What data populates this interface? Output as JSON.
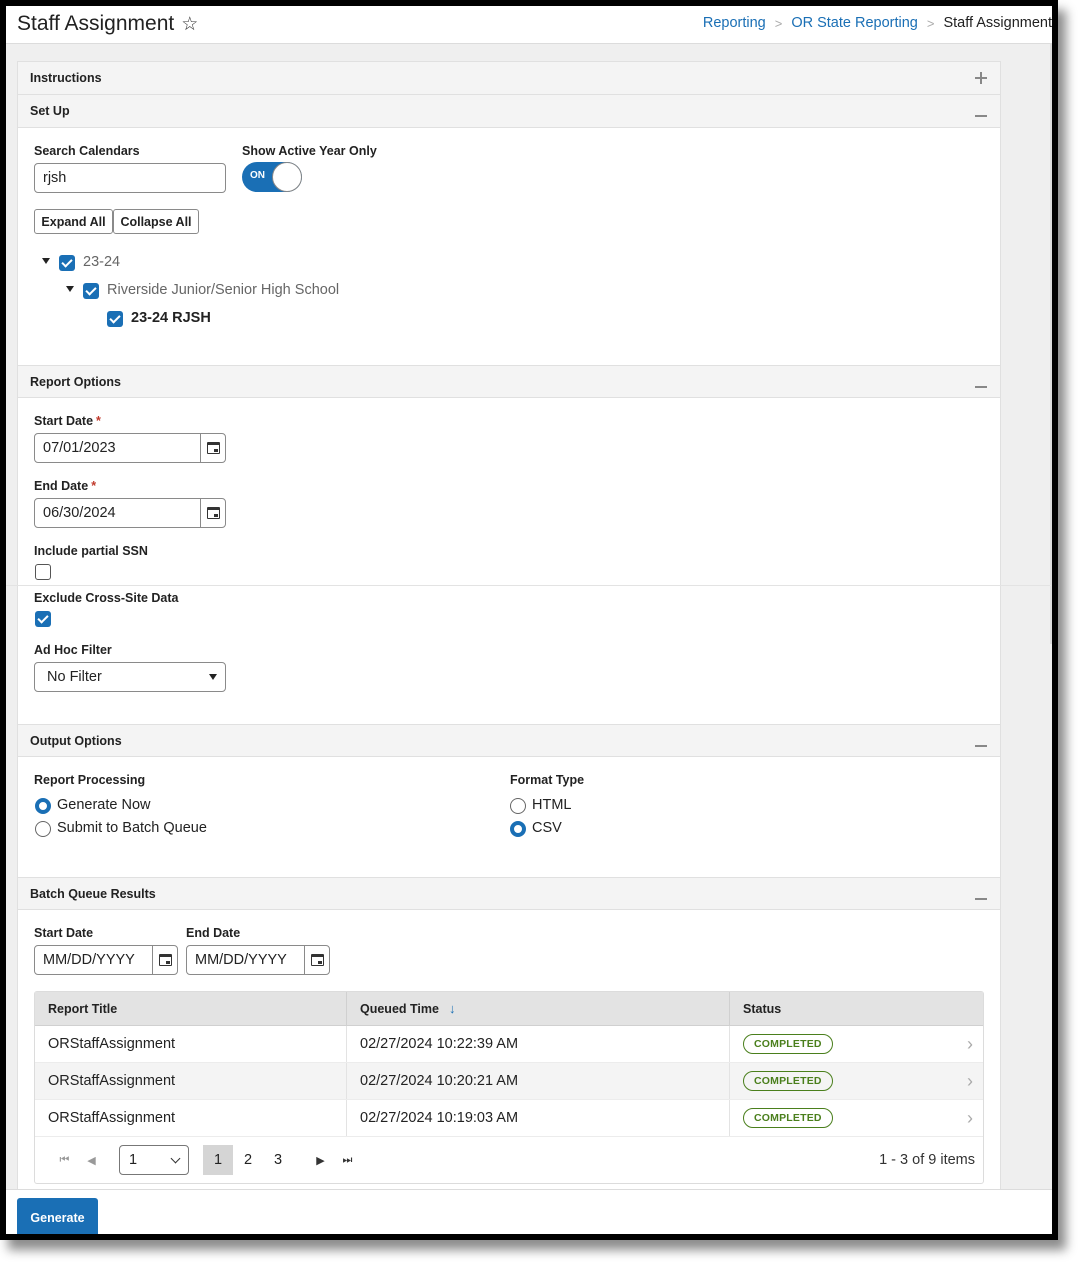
{
  "header": {
    "title": "Staff Assignment",
    "favorite_icon": "star-outline-icon",
    "breadcrumb": [
      {
        "label": "Reporting",
        "link": true
      },
      {
        "label": "OR State Reporting",
        "link": true
      },
      {
        "label": "Staff Assignment",
        "link": false
      }
    ],
    "breadcrumb_separator": ">"
  },
  "sections": {
    "instructions": {
      "title": "Instructions",
      "state": "collapsed"
    },
    "setup": {
      "title": "Set Up",
      "state": "expanded"
    },
    "report_options": {
      "title": "Report Options",
      "state": "expanded"
    },
    "output_options": {
      "title": "Output Options",
      "state": "expanded"
    },
    "batch_queue": {
      "title": "Batch Queue Results",
      "state": "expanded"
    }
  },
  "setup": {
    "search_label": "Search Calendars",
    "search_value": "rjsh",
    "active_year_label": "Show Active Year Only",
    "active_year_toggle": "ON",
    "expand_all": "Expand All",
    "collapse_all": "Collapse All",
    "tree": [
      {
        "label": "23-24",
        "checked": true,
        "level": 0
      },
      {
        "label": "Riverside Junior/Senior High School",
        "checked": true,
        "level": 1
      },
      {
        "label": "23-24 RJSH",
        "checked": true,
        "level": 2
      }
    ]
  },
  "report_options": {
    "start_date_label": "Start Date",
    "start_date_value": "07/01/2023",
    "end_date_label": "End Date",
    "end_date_value": "06/30/2024",
    "required_mark": "*",
    "partial_ssn_label": "Include partial SSN",
    "partial_ssn_checked": false,
    "cross_site_label": "Exclude Cross-Site Data",
    "cross_site_checked": true,
    "adhoc_label": "Ad Hoc Filter",
    "adhoc_value": "No Filter"
  },
  "output_options": {
    "processing_label": "Report Processing",
    "processing_options": [
      {
        "label": "Generate Now",
        "selected": true
      },
      {
        "label": "Submit to Batch Queue",
        "selected": false
      }
    ],
    "format_label": "Format Type",
    "format_options": [
      {
        "label": "HTML",
        "selected": false
      },
      {
        "label": "CSV",
        "selected": true
      }
    ]
  },
  "batch_queue": {
    "start_date_label": "Start Date",
    "start_date_placeholder": "MM/DD/YYYY",
    "end_date_label": "End Date",
    "end_date_placeholder": "MM/DD/YYYY",
    "columns": [
      "Report Title",
      "Queued Time",
      "Status"
    ],
    "sort_column": "Queued Time",
    "sort_direction": "descending",
    "rows": [
      {
        "title": "ORStaffAssignment",
        "queued": "02/27/2024 10:22:39 AM",
        "status": "COMPLETED"
      },
      {
        "title": "ORStaffAssignment",
        "queued": "02/27/2024 10:20:21 AM",
        "status": "COMPLETED"
      },
      {
        "title": "ORStaffAssignment",
        "queued": "02/27/2024 10:19:03 AM",
        "status": "COMPLETED"
      }
    ],
    "pager": {
      "page_select_value": "1",
      "pages": [
        "1",
        "2",
        "3"
      ],
      "current_page": "1",
      "info": "1 - 3 of 9 items"
    }
  },
  "footer": {
    "generate_label": "Generate"
  },
  "colors": {
    "accent": "#1a6fb5",
    "status_completed": "#4a7f1c",
    "required": "#c0392b"
  }
}
